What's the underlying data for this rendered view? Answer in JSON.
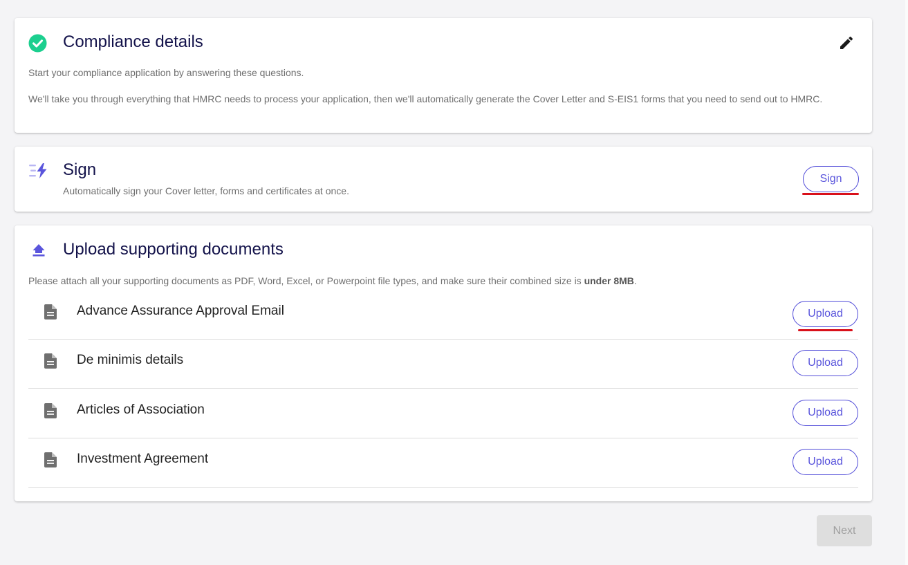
{
  "compliance": {
    "title": "Compliance details",
    "intro": "Start your compliance application by answering these questions.",
    "description": "We'll take you through everything that HMRC needs to process your application, then we'll automatically generate the Cover Letter and S-EIS1 forms that you need to send out to HMRC.",
    "status_icon": "check-circle-icon",
    "edit_icon": "pencil-icon",
    "colors": {
      "check": "#1ccf8f"
    }
  },
  "sign": {
    "title": "Sign",
    "description": "Automatically sign your Cover letter, forms and certificates at once.",
    "button_label": "Sign",
    "icon": "fast-sign-icon"
  },
  "upload": {
    "title": "Upload supporting documents",
    "description_prefix": "Please attach all your supporting documents as PDF, Word, Excel, or Powerpoint file types, and make sure their combined size is ",
    "description_bold": "under 8MB",
    "description_suffix": ".",
    "icon": "upload-icon",
    "documents": [
      {
        "label": "Advance Assurance Approval Email",
        "button_label": "Upload"
      },
      {
        "label": "De minimis details",
        "button_label": "Upload"
      },
      {
        "label": "Articles of Association",
        "button_label": "Upload"
      },
      {
        "label": "Investment Agreement",
        "button_label": "Upload"
      }
    ]
  },
  "footer": {
    "next_label": "Next"
  },
  "colors": {
    "accent": "#5a55dc",
    "title": "#13124a",
    "annotation_red": "#d9101a",
    "disabled_bg": "#dedede"
  }
}
